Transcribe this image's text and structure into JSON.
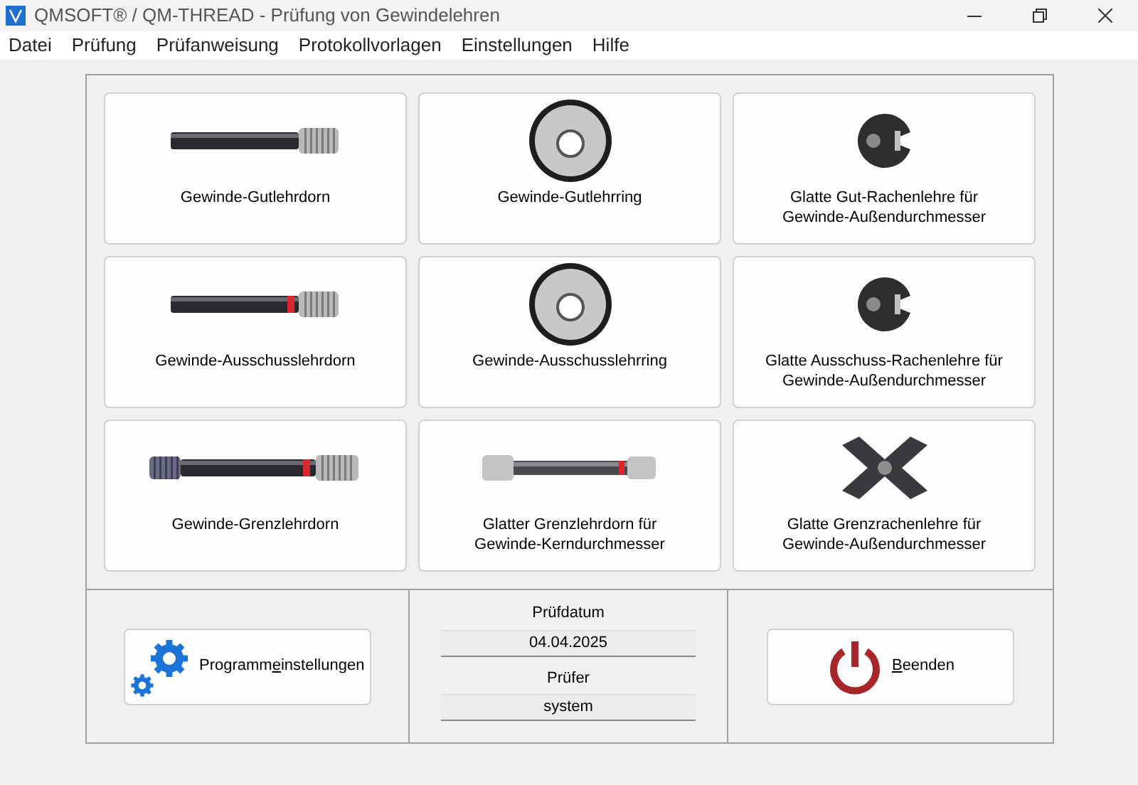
{
  "window": {
    "title": "QMSOFT® / QM-THREAD - Prüfung von Gewindelehren"
  },
  "menu": [
    "Datei",
    "Prüfung",
    "Prüfanweisung",
    "Protokollvorlagen",
    "Einstellungen",
    "Hilfe"
  ],
  "gauges": [
    {
      "kind": "plug",
      "label": "Gewinde-Gutlehrdorn"
    },
    {
      "kind": "ring",
      "label": "Gewinde-Gutlehrring"
    },
    {
      "kind": "snap",
      "label": "Glatte Gut-Rachenlehre für Gewinde-Außendurchmesser"
    },
    {
      "kind": "plug_red",
      "label": "Gewinde-Ausschusslehrdorn"
    },
    {
      "kind": "ring",
      "label": "Gewinde-Ausschusslehrring"
    },
    {
      "kind": "snap",
      "label": "Glatte Ausschuss-Rachenlehre für Gewinde-Außendurchmesser"
    },
    {
      "kind": "limit_plug",
      "label": "Gewinde-Grenzlehrdorn"
    },
    {
      "kind": "limit_smooth",
      "label": "Glatter Grenzlehrdorn für Gewinde-Kerndurchmesser"
    },
    {
      "kind": "limit_snap",
      "label": "Glatte Grenzrachenlehre für Gewinde-Außendurchmesser"
    }
  ],
  "settings_button": {
    "label_parts": [
      {
        "text": "Programm",
        "underline": false
      },
      {
        "text": "e",
        "underline": true
      },
      {
        "text": "instellungen",
        "underline": false
      }
    ]
  },
  "test_date": {
    "label": "Prüfdatum",
    "value": "04.04.2025"
  },
  "inspector": {
    "label": "Prüfer",
    "value": "system"
  },
  "exit_button": {
    "label_parts": [
      {
        "text": "B",
        "underline": true
      },
      {
        "text": "eenden",
        "underline": false
      }
    ]
  }
}
